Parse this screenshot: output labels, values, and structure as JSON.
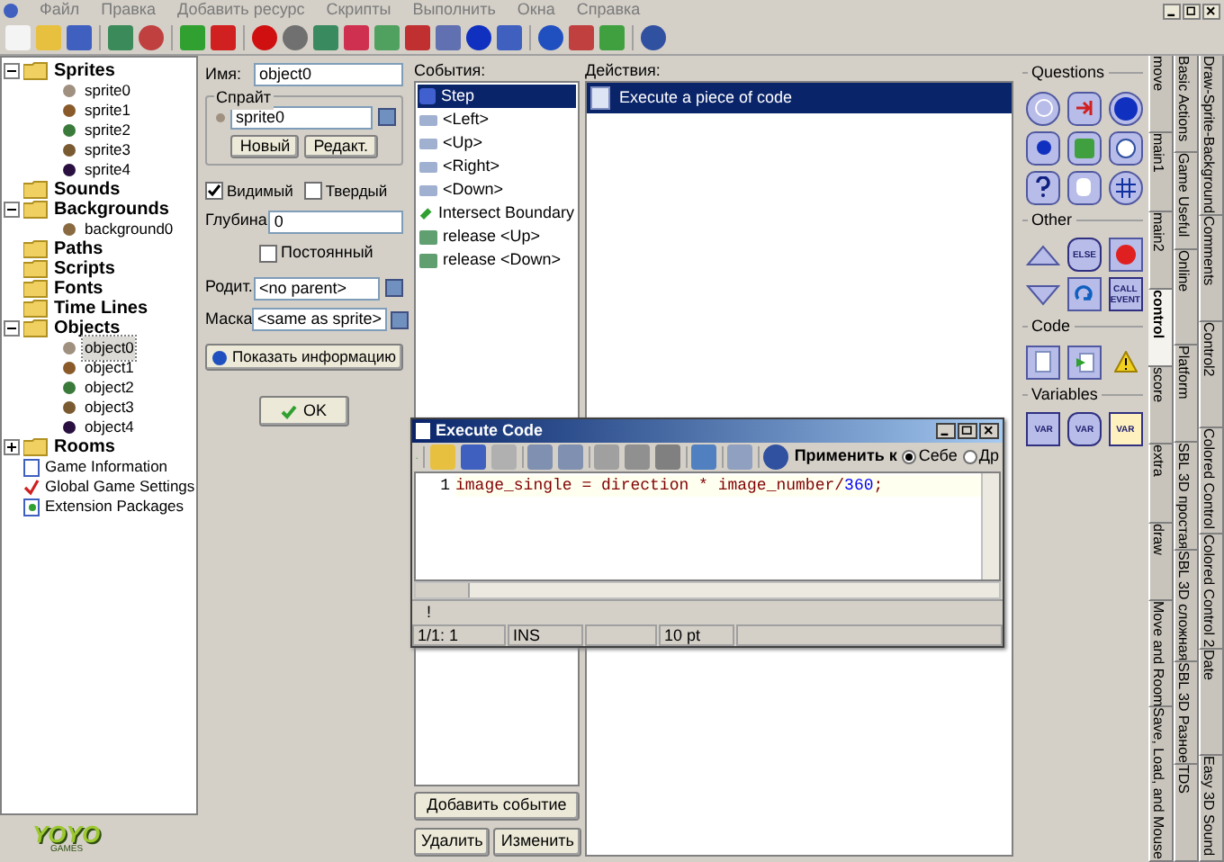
{
  "menu": [
    "Файл",
    "Правка",
    "Добавить ресурс",
    "Скрипты",
    "Выполнить",
    "Окна",
    "Справка"
  ],
  "tree": [
    {
      "label": "Sprites",
      "kind": "folder",
      "expanded": true,
      "selected": false,
      "children": [
        {
          "label": "sprite0",
          "kind": "resource",
          "color": "#a09080",
          "selected": false
        },
        {
          "label": "sprite1",
          "kind": "resource",
          "color": "#8a5a2b",
          "selected": false
        },
        {
          "label": "sprite2",
          "kind": "resource",
          "color": "#3a7a3a",
          "selected": false
        },
        {
          "label": "sprite3",
          "kind": "resource",
          "color": "#7a5a30",
          "selected": false
        },
        {
          "label": "sprite4",
          "kind": "resource",
          "color": "#2a1040",
          "selected": false
        }
      ]
    },
    {
      "label": "Sounds",
      "kind": "folder",
      "selected": false
    },
    {
      "label": "Backgrounds",
      "kind": "folder",
      "expanded": true,
      "selected": false,
      "children": [
        {
          "label": "background0",
          "kind": "resource",
          "color": "#8a6a40",
          "selected": false
        }
      ]
    },
    {
      "label": "Paths",
      "kind": "folder",
      "selected": false
    },
    {
      "label": "Scripts",
      "kind": "folder",
      "selected": false
    },
    {
      "label": "Fonts",
      "kind": "folder",
      "selected": false
    },
    {
      "label": "Time Lines",
      "kind": "folder",
      "selected": false
    },
    {
      "label": "Objects",
      "kind": "folder",
      "expanded": true,
      "selected": false,
      "children": [
        {
          "label": "object0",
          "kind": "resource",
          "color": "#a09080",
          "selected": true
        },
        {
          "label": "object1",
          "kind": "resource",
          "color": "#8a5a2b",
          "selected": false
        },
        {
          "label": "object2",
          "kind": "resource",
          "color": "#3a7a3a",
          "selected": false
        },
        {
          "label": "object3",
          "kind": "resource",
          "color": "#7a5a30",
          "selected": false
        },
        {
          "label": "object4",
          "kind": "resource",
          "color": "#2a1040",
          "selected": false
        }
      ]
    },
    {
      "label": "Rooms",
      "kind": "folder",
      "expanded": false,
      "selected": false
    },
    {
      "label": "Game Information",
      "kind": "info",
      "selected": false
    },
    {
      "label": "Global Game Settings",
      "kind": "settings",
      "selected": false
    },
    {
      "label": "Extension Packages",
      "kind": "extension",
      "selected": false
    }
  ],
  "logo": {
    "top": "YOYO",
    "bottom": "GAMES"
  },
  "object": {
    "name_label": "Имя:",
    "name_value": "object0",
    "sprite_group": "Спрайт",
    "sprite_value": "sprite0",
    "sprite_buttons": [
      "Новый",
      "Редакт."
    ],
    "visible": {
      "label": "Видимый",
      "checked": true
    },
    "solid": {
      "label": "Твердый",
      "checked": false
    },
    "depth_label": "Глубина",
    "depth_value": "0",
    "persistent": {
      "label": "Постоянный",
      "checked": false
    },
    "parent_label": "Родит.",
    "parent_value": "<no parent>",
    "mask_label": "Маска",
    "mask_value": "<same as sprite>",
    "info_button": "Показать информацию",
    "ok_button": "OK"
  },
  "events": {
    "label": "События:",
    "items": [
      {
        "label": "Step",
        "kind": "step",
        "selected": true
      },
      {
        "label": "<Left>",
        "kind": "key",
        "selected": false
      },
      {
        "label": "<Up>",
        "kind": "key",
        "selected": false
      },
      {
        "label": "<Right>",
        "kind": "key",
        "selected": false
      },
      {
        "label": "<Down>",
        "kind": "key",
        "selected": false
      },
      {
        "label": "Intersect Boundary",
        "kind": "other",
        "selected": false
      },
      {
        "label": "release <Up>",
        "kind": "release",
        "selected": false
      },
      {
        "label": "release <Down>",
        "kind": "release",
        "selected": false
      }
    ],
    "add_button": "Добавить событие"
  },
  "actions": {
    "label": "Действия:",
    "items": [
      {
        "label": "Execute a piece of code",
        "selected": true
      }
    ],
    "buttons": [
      "Удалить",
      "Изменить"
    ]
  },
  "code_window": {
    "title": "Execute Code",
    "apply_label": "Применить к",
    "radios": [
      {
        "label": "Себе",
        "selected": true
      },
      {
        "label": "Др",
        "selected": false
      }
    ],
    "lines": [
      {
        "number": "1",
        "tokens": [
          {
            "text": "image_single = direction * image_number/",
            "kind": "plain"
          },
          {
            "text": "360",
            "kind": "number"
          },
          {
            "text": ";",
            "kind": "plain"
          }
        ]
      }
    ],
    "message": "!",
    "status": [
      "1/1: 1",
      "INS",
      "10 pt"
    ]
  },
  "palette": [
    {
      "title": "Questions",
      "items": [
        {
          "kind": "ring"
        },
        {
          "kind": "exit"
        },
        {
          "kind": "sphere"
        },
        {
          "kind": "sphere-small"
        },
        {
          "kind": "dice"
        },
        {
          "kind": "query-round"
        },
        {
          "kind": "query"
        },
        {
          "kind": "hand"
        },
        {
          "kind": "grid"
        }
      ]
    },
    {
      "title": "Other",
      "items": [
        {
          "kind": "up"
        },
        {
          "kind": "tag-round",
          "text": "ELSE"
        },
        {
          "kind": "stop"
        },
        {
          "kind": "down"
        },
        {
          "kind": "loop"
        },
        {
          "kind": "tag",
          "text": "CALL EVENT"
        }
      ]
    },
    {
      "title": "Code",
      "items": [
        {
          "kind": "page"
        },
        {
          "kind": "page-run"
        },
        {
          "kind": "warning"
        }
      ]
    },
    {
      "title": "Variables",
      "items": [
        {
          "kind": "tag",
          "text": "VAR"
        },
        {
          "kind": "tag-round",
          "text": "VAR"
        },
        {
          "kind": "tag-light",
          "text": "VAR"
        }
      ]
    }
  ],
  "tab_columns": [
    [
      {
        "label": "move",
        "selected": false
      },
      {
        "label": "main1",
        "selected": false
      },
      {
        "label": "main2",
        "selected": false
      },
      {
        "label": "control",
        "selected": true
      },
      {
        "label": "score",
        "selected": false
      },
      {
        "label": "extra",
        "selected": false
      },
      {
        "label": "draw",
        "selected": false
      },
      {
        "label": "Move and Room",
        "selected": false
      },
      {
        "label": "Save, Load, and Mouse",
        "selected": false
      }
    ],
    [
      {
        "label": "Basic Actions",
        "selected": false
      },
      {
        "label": "Game Useful",
        "selected": false
      },
      {
        "label": "Online",
        "selected": false
      },
      {
        "label": "Platform",
        "selected": false
      },
      {
        "label": "SBL 3D простая",
        "selected": false
      },
      {
        "label": "SBL 3D сложная",
        "selected": false
      },
      {
        "label": "SBL 3D Разное",
        "selected": false
      },
      {
        "label": "TDS",
        "selected": false
      }
    ],
    [
      {
        "label": "Draw-Sprite-Background",
        "selected": false
      },
      {
        "label": "Comments",
        "selected": false
      },
      {
        "label": "Control2",
        "selected": false
      },
      {
        "label": "Colored Control",
        "selected": false
      },
      {
        "label": "Colored Control 2",
        "selected": false
      },
      {
        "label": "Date",
        "selected": false
      },
      {
        "label": "Easy 3D Sound",
        "selected": false
      }
    ]
  ]
}
